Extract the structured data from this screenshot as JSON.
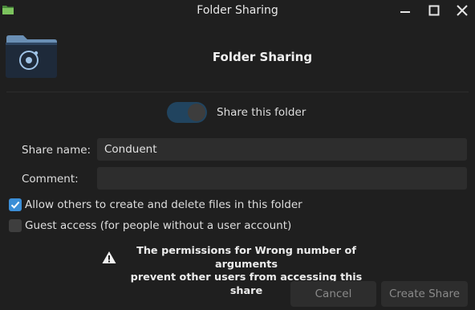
{
  "window": {
    "title": "Folder Sharing",
    "buttons": [
      "minimize",
      "maximize",
      "close"
    ]
  },
  "header": {
    "title": "Folder Sharing",
    "icon": "folder-share-icon"
  },
  "share_toggle": {
    "label": "Share this folder",
    "state": "on"
  },
  "form": {
    "share_name_label": "Share name:",
    "share_name_value": "Conduent",
    "comment_label": "Comment:",
    "comment_value": ""
  },
  "options": [
    {
      "label": "Allow others to create and delete files in this folder",
      "checked": true
    },
    {
      "label": "Guest access (for people without a user account)",
      "checked": false
    }
  ],
  "warning": {
    "line1": "The permissions for Wrong number of arguments",
    "line2": "prevent other users from accessing this share"
  },
  "actions": {
    "cancel": "Cancel",
    "create": "Create Share"
  },
  "colors": {
    "accent": "#3b8ed7",
    "toggle_track": "#21445f",
    "background": "#1f1f1f",
    "input_bg": "#2d2d2d"
  }
}
